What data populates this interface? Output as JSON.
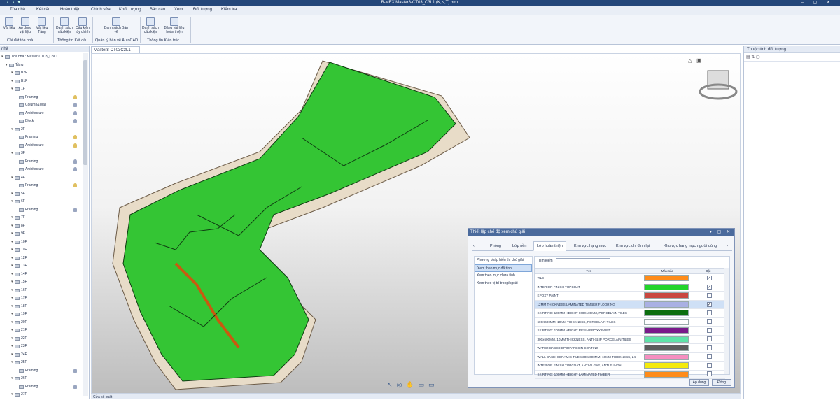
{
  "window": {
    "title": "B-MEX Master8-CT03_C3L1 (K,N,T).bmx"
  },
  "ribbon_tabs": [
    "Tòa nhà",
    "Kết cấu",
    "Hoàn thiện",
    "Chỉnh sửa",
    "Khối Lượng",
    "Báo cáo",
    "Xem",
    "Đối tượng",
    "Kiểm tra"
  ],
  "ribbon": {
    "buttons": [
      "Vật liệu",
      "Áp dụng vật liệu",
      "Vật liệu Tầng",
      "Danh sách cấu kiện",
      "Cấu kiện tùy chỉnh",
      "Danh sách Bản vẽ",
      "Danh sách cấu kiện",
      "Bảng vật liệu hoàn thiện"
    ],
    "groups": [
      "Cài đặt tòa nhà",
      "Thông tin Kết cấu",
      "Quản lý bản vẽ AutoCAD",
      "Thông tin Kiến trúc"
    ]
  },
  "left_panel": {
    "title": "nhà",
    "items": [
      {
        "label": "Tòa nhà : Master-CT03_C3L1",
        "level": 0
      },
      {
        "label": "Tầng",
        "level": 1
      },
      {
        "label": "B2F",
        "level": 2
      },
      {
        "label": "B1F",
        "level": 2
      },
      {
        "label": "1F",
        "level": 2
      },
      {
        "label": "Framing",
        "level": 3,
        "bulb": "#e0c060"
      },
      {
        "label": "Column&Wall",
        "level": 3,
        "bulb": "#9aa6c0"
      },
      {
        "label": "Architecture",
        "level": 3,
        "bulb": "#9aa6c0"
      },
      {
        "label": "Block",
        "level": 3,
        "bulb": "#9aa6c0"
      },
      {
        "label": "2F",
        "level": 2
      },
      {
        "label": "Framing",
        "level": 3,
        "bulb": "#e0c060"
      },
      {
        "label": "Architecture",
        "level": 3,
        "bulb": "#e0c060"
      },
      {
        "label": "3F",
        "level": 2
      },
      {
        "label": "Framing",
        "level": 3,
        "bulb": "#9aa6c0"
      },
      {
        "label": "Architecture",
        "level": 3,
        "bulb": "#9aa6c0"
      },
      {
        "label": "4F",
        "level": 2
      },
      {
        "label": "Framing",
        "level": 3,
        "bulb": "#e0c060"
      },
      {
        "label": "5F",
        "level": 2
      },
      {
        "label": "6F",
        "level": 2
      },
      {
        "label": "Framing",
        "level": 3,
        "bulb": "#9aa6c0"
      },
      {
        "label": "7F",
        "level": 2
      },
      {
        "label": "8F",
        "level": 2
      },
      {
        "label": "9F",
        "level": 2
      },
      {
        "label": "10F",
        "level": 2
      },
      {
        "label": "11F",
        "level": 2
      },
      {
        "label": "12F",
        "level": 2
      },
      {
        "label": "13F",
        "level": 2
      },
      {
        "label": "14F",
        "level": 2
      },
      {
        "label": "15F",
        "level": 2
      },
      {
        "label": "16F",
        "level": 2
      },
      {
        "label": "17F",
        "level": 2
      },
      {
        "label": "18F",
        "level": 2
      },
      {
        "label": "19F",
        "level": 2
      },
      {
        "label": "20F",
        "level": 2
      },
      {
        "label": "21F",
        "level": 2
      },
      {
        "label": "22F",
        "level": 2
      },
      {
        "label": "23F",
        "level": 2
      },
      {
        "label": "24F",
        "level": 2
      },
      {
        "label": "25F",
        "level": 2
      },
      {
        "label": "Framing",
        "level": 3,
        "bulb": "#9aa6c0"
      },
      {
        "label": "26F",
        "level": 2
      },
      {
        "label": "Framing",
        "level": 3,
        "bulb": "#9aa6c0"
      },
      {
        "label": "27F",
        "level": 2
      }
    ]
  },
  "document_tab": "Master8-CT03C3L1",
  "right_panel": {
    "title": "Thuộc tính đối tượng"
  },
  "bottom_panel": {
    "title": "Cửa sổ xuất"
  },
  "dialog": {
    "title": "Thiết lập chế độ xem chú giải",
    "tabs": [
      "Phòng",
      "Lớp nền",
      "Lớp hoàn thiện",
      "Khu vực hạng mục",
      "Khu vực chỉ định lại",
      "Khu vực hạng mục người dùng"
    ],
    "active_tab": "Lớp hoàn thiện",
    "left_title": "Phương pháp hiển thị chú giải",
    "modes": [
      "Xem theo mục đã tính",
      "Xem theo mục chưa tính",
      "Xem theo vị trí trong/ngoài"
    ],
    "search_label": "Tìm kiếm",
    "columns": [
      "Tên",
      "Màu sắc",
      "Bật"
    ],
    "rows": [
      {
        "name": "TILE",
        "color": "#ff8c1a",
        "on": true
      },
      {
        "name": "INTERIOR FINISH TOPCOAT",
        "color": "#22d42a",
        "on": true
      },
      {
        "name": "EPOXY PAINT",
        "color": "#c9473f",
        "on": false
      },
      {
        "name": "12MM THICKNESS LAMINATED TIMBER FLOORING",
        "color": "#a9b0e3",
        "on": true,
        "selected": true
      },
      {
        "name": "SKIRTING: 100MM HEIGHT 600X100MM, PORCELAIN TILES",
        "color": "#0b6e0e",
        "on": false
      },
      {
        "name": "600X600MM, 10MM THICKNESS, PORCELAIN TILES",
        "color": "#ffffff",
        "on": false
      },
      {
        "name": "SKIRTING: 100MM HEIGHT RESIN EPOXY PAINT",
        "color": "#7a1a8a",
        "on": false
      },
      {
        "name": "300x600MM, 10MM THICKNESS, ANTI-SLIP PORCELAIN TILES",
        "color": "#5fe3a8",
        "on": false
      },
      {
        "name": "WATER-BASED EPOXY RESIN COATING",
        "color": "#5c5c5c",
        "on": false
      },
      {
        "name": "WALL BASE: CERAMIC TILES 300x600MM, 10MM THICKNESS, 24",
        "color": "#f58fc0",
        "on": false
      },
      {
        "name": "INTERIOR FINISH TOPCOAT, ANTI ALGAE, ANTI FUNGAL",
        "color": "#f4ea0c",
        "on": false
      },
      {
        "name": "SKIRTING: 100MM HEIGHT LAMINATED TIMBER",
        "color": "#ff8c1a",
        "on": false
      }
    ],
    "buttons": {
      "apply": "Áp dụng",
      "close": "Đóng"
    }
  }
}
